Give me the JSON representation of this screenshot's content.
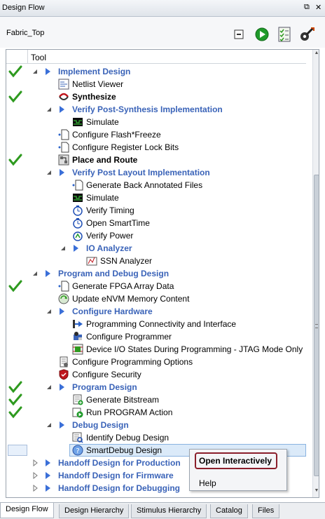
{
  "window": {
    "title": "Design Flow",
    "restore_glyph": "⧉",
    "close_glyph": "✕"
  },
  "module": "Fabric_Top",
  "toolbar": [
    {
      "name": "collapse-all-button",
      "icon": "minus-box-icon"
    },
    {
      "name": "run-button",
      "icon": "play-green-icon"
    },
    {
      "name": "report-button",
      "icon": "checklist-icon"
    },
    {
      "name": "options-button",
      "icon": "tools-gear-icon"
    }
  ],
  "column_header": "Tool",
  "rows": [
    {
      "label": "Implement Design",
      "style": "section",
      "level": 0,
      "expanded": true,
      "check": true,
      "icon": "arrow"
    },
    {
      "label": "Netlist Viewer",
      "style": "normal",
      "level": 1,
      "icon": "netlist-viewer-icon"
    },
    {
      "label": "Synthesize",
      "style": "bold",
      "level": 1,
      "check": true,
      "icon": "synthesize-icon"
    },
    {
      "label": "Verify Post-Synthesis Implementation",
      "style": "section",
      "level": 1,
      "expanded": true,
      "icon": "arrow"
    },
    {
      "label": "Simulate",
      "style": "normal",
      "level": 2,
      "icon": "simulate-icon"
    },
    {
      "label": "Configure Flash*Freeze",
      "style": "normal",
      "level": 1,
      "icon": "config-doc-icon"
    },
    {
      "label": "Configure Register Lock Bits",
      "style": "normal",
      "level": 1,
      "icon": "config-doc-icon"
    },
    {
      "label": "Place and Route",
      "style": "bold",
      "level": 1,
      "check": true,
      "icon": "place-route-icon"
    },
    {
      "label": "Verify Post Layout Implementation",
      "style": "section",
      "level": 1,
      "expanded": true,
      "icon": "arrow"
    },
    {
      "label": "Generate Back Annotated Files",
      "style": "normal",
      "level": 2,
      "icon": "config-doc-icon"
    },
    {
      "label": "Simulate",
      "style": "normal",
      "level": 2,
      "icon": "simulate-icon"
    },
    {
      "label": "Verify Timing",
      "style": "normal",
      "level": 2,
      "icon": "timing-icon"
    },
    {
      "label": "Open SmartTime",
      "style": "normal",
      "level": 2,
      "icon": "timing-icon"
    },
    {
      "label": "Verify Power",
      "style": "normal",
      "level": 2,
      "icon": "power-icon"
    },
    {
      "label": "IO Analyzer",
      "style": "section",
      "level": 2,
      "expanded": true,
      "icon": "arrow"
    },
    {
      "label": "SSN Analyzer",
      "style": "normal",
      "level": 3,
      "icon": "ssn-icon"
    },
    {
      "label": "Program and Debug Design",
      "style": "section",
      "level": 0,
      "expanded": true,
      "icon": "arrow"
    },
    {
      "label": "Generate FPGA Array Data",
      "style": "normal",
      "level": 1,
      "check": true,
      "icon": "config-doc-icon"
    },
    {
      "label": "Update eNVM Memory Content",
      "style": "normal",
      "level": 1,
      "icon": "envm-icon"
    },
    {
      "label": "Configure Hardware",
      "style": "section",
      "level": 1,
      "expanded": true,
      "icon": "arrow"
    },
    {
      "label": "Programming Connectivity and Interface",
      "style": "normal",
      "level": 2,
      "icon": "connectivity-icon"
    },
    {
      "label": "Configure Programmer",
      "style": "normal",
      "level": 2,
      "icon": "programmer-icon"
    },
    {
      "label": "Device I/O States During Programming - JTAG Mode Only",
      "style": "normal",
      "level": 2,
      "icon": "io-states-icon"
    },
    {
      "label": "Configure Programming Options",
      "style": "normal",
      "level": 1,
      "icon": "prog-options-icon"
    },
    {
      "label": "Configure Security",
      "style": "normal",
      "level": 1,
      "icon": "security-shield-icon"
    },
    {
      "label": "Program Design",
      "style": "section",
      "level": 1,
      "expanded": true,
      "check": true,
      "icon": "arrow"
    },
    {
      "label": "Generate Bitstream",
      "style": "normal",
      "level": 2,
      "check": true,
      "icon": "bitstream-icon"
    },
    {
      "label": "Run PROGRAM Action",
      "style": "normal",
      "level": 2,
      "check": true,
      "icon": "run-program-icon"
    },
    {
      "label": "Debug Design",
      "style": "section",
      "level": 1,
      "expanded": true,
      "icon": "arrow"
    },
    {
      "label": "Identify Debug Design",
      "style": "normal",
      "level": 2,
      "icon": "identify-icon"
    },
    {
      "label": "SmartDebug Design",
      "style": "normal",
      "level": 2,
      "selected": true,
      "icon": "smartdebug-icon"
    },
    {
      "label": "Handoff Design for Production",
      "style": "section",
      "level": 0,
      "expanded": false,
      "icon": "arrow"
    },
    {
      "label": "Handoff Design for Firmware",
      "style": "section",
      "level": 0,
      "expanded": false,
      "icon": "arrow"
    },
    {
      "label": "Handoff Design for Debugging",
      "style": "section",
      "level": 0,
      "expanded": false,
      "icon": "arrow"
    }
  ],
  "context_menu": {
    "items": [
      "Open Interactively",
      "Help"
    ],
    "highlighted": "Open Interactively"
  },
  "tabs": [
    {
      "label": "Design Flow",
      "active": true
    },
    {
      "label": "Design Hierarchy",
      "active": false
    },
    {
      "label": "Stimulus Hierarchy",
      "active": false
    },
    {
      "label": "Catalog",
      "active": false
    },
    {
      "label": "Files",
      "active": false
    }
  ],
  "colors": {
    "section_text": "#3a63b8",
    "check_green": "#2e9a1f",
    "arrow_blue": "#3a6fd8",
    "highlight_ring": "#8b1f2b"
  }
}
